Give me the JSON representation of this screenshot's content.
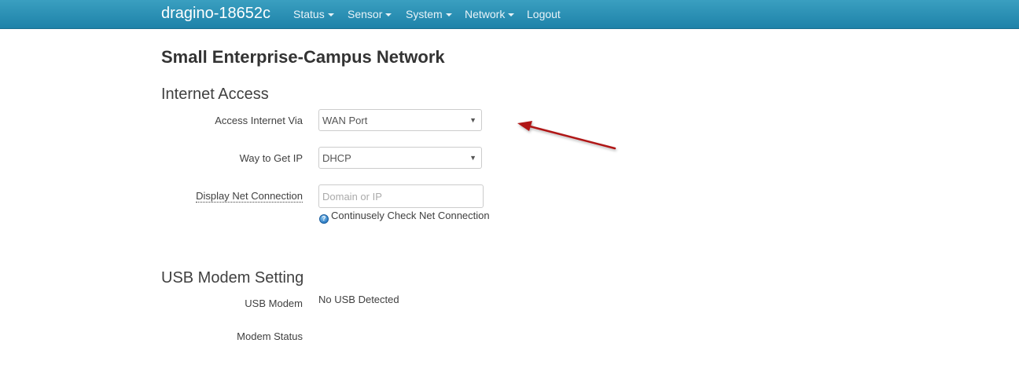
{
  "navbar": {
    "brand": "dragino-18652c",
    "items": [
      {
        "label": "Status",
        "has_caret": true
      },
      {
        "label": "Sensor",
        "has_caret": true
      },
      {
        "label": "System",
        "has_caret": true
      },
      {
        "label": "Network",
        "has_caret": true
      },
      {
        "label": "Logout",
        "has_caret": false
      }
    ],
    "background_color": "#2a8fb5"
  },
  "page": {
    "title": "Small Enterprise-Campus Network"
  },
  "internet_access": {
    "title": "Internet Access",
    "access_internet_via": {
      "label": "Access Internet Via",
      "value": "WAN Port"
    },
    "way_to_get_ip": {
      "label": "Way to Get IP",
      "value": "DHCP"
    },
    "display_net_connection": {
      "label": "Display Net Connection",
      "value": "",
      "placeholder": "Domain or IP",
      "help_text": "Continusely Check Net Connection"
    }
  },
  "usb_modem": {
    "title": "USB Modem Setting",
    "usb_modem": {
      "label": "USB Modem",
      "value": "No USB Detected"
    },
    "modem_status": {
      "label": "Modem Status",
      "value": ""
    }
  },
  "annotation": {
    "arrow_color": "#b01818",
    "icon": "red-arrow-icon"
  }
}
